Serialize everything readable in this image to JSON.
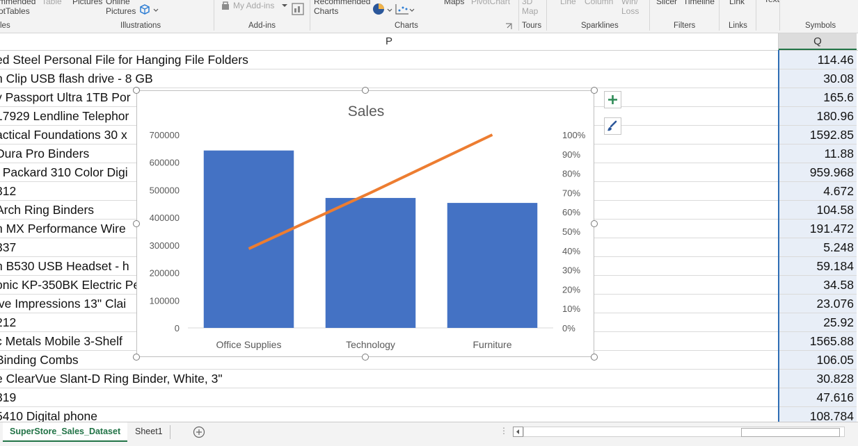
{
  "ribbon": {
    "items": [
      {
        "id": "rec-pivot",
        "lines": [
          "mmended",
          "otTables"
        ]
      },
      {
        "id": "table",
        "lines": [
          "Table"
        ],
        "gray": true
      },
      {
        "id": "pictures",
        "lines": [
          "Pictures"
        ]
      },
      {
        "id": "online-pictures",
        "lines": [
          "Online",
          "Pictures"
        ]
      },
      {
        "id": "my-addins",
        "lines": [
          "My Add-ins"
        ],
        "gray": true
      },
      {
        "id": "rec-charts",
        "lines": [
          "Recommended",
          "Charts"
        ]
      },
      {
        "id": "maps",
        "lines": [
          "Maps"
        ]
      },
      {
        "id": "pivotchart",
        "lines": [
          "PivotChart"
        ],
        "gray": true
      },
      {
        "id": "3dmap",
        "lines": [
          "3D",
          "Map"
        ],
        "gray": true
      },
      {
        "id": "line",
        "lines": [
          "Line"
        ],
        "gray": true
      },
      {
        "id": "column",
        "lines": [
          "Column"
        ],
        "gray": true
      },
      {
        "id": "winloss",
        "lines": [
          "Win/",
          "Loss"
        ],
        "gray": true
      },
      {
        "id": "slicer",
        "lines": [
          "Slicer"
        ]
      },
      {
        "id": "timeline",
        "lines": [
          "Timeline"
        ]
      },
      {
        "id": "link",
        "lines": [
          "Link"
        ]
      },
      {
        "id": "text",
        "lines": [
          "Text"
        ]
      }
    ],
    "groups": [
      "les",
      "Illustrations",
      "Add-ins",
      "Charts",
      "Tours",
      "Sparklines",
      "Filters",
      "Links",
      "Symbols"
    ]
  },
  "columns": {
    "p": "P",
    "q": "Q"
  },
  "rows": [
    {
      "p": "ed Steel Personal File for Hanging File Folders",
      "q": "114.46"
    },
    {
      "p": "n Clip USB flash drive - 8 GB",
      "q": "30.08"
    },
    {
      "p": "y Passport Ultra 1TB Por",
      "q": "165.6"
    },
    {
      "p": "17929 Lendline Telephor",
      "q": "180.96"
    },
    {
      "p": "actical Foundations 30 x",
      "q": "1592.85"
    },
    {
      "p": "Dura Pro Binders",
      "q": "11.88"
    },
    {
      "p": "t Packard 310 Color Digi",
      "q": "959.968"
    },
    {
      "p": " 312",
      "q": "4.672"
    },
    {
      "p": "Arch Ring Binders",
      "q": "104.58"
    },
    {
      "p": "h MX Performance Wire",
      "q": "191.472"
    },
    {
      "p": " 337",
      "q": "5.248"
    },
    {
      "p": "h B530 USB Headset - h",
      "q": "59.184"
    },
    {
      "p": "onic KP-350BK Electric Pe",
      "q": "34.58"
    },
    {
      "p": "ive Impressions 13\" Clai",
      "q": "23.076"
    },
    {
      "p": "212",
      "q": "25.92"
    },
    {
      "p": "c Metals Mobile 3-Shelf",
      "q": "1565.88"
    },
    {
      "p": "Binding Combs",
      "q": "106.05"
    },
    {
      "p": "e ClearVue Slant-D Ring Binder, White, 3\"",
      "q": "30.828"
    },
    {
      "p": " 319",
      "q": "47.616"
    },
    {
      "p": "5410 Digital phone",
      "q": "108.784"
    }
  ],
  "tabs": {
    "active": "SuperStore_Sales_Dataset",
    "other": "Sheet1"
  },
  "colors": {
    "bar": "#4472c4",
    "line": "#ed7d31",
    "excel_green": "#217346",
    "selection": "#2e6db4"
  },
  "chart_data": {
    "type": "bar",
    "title": "Sales",
    "categories": [
      "Office Supplies",
      "Technology",
      "Furniture"
    ],
    "series": [
      {
        "kind": "bar",
        "axis": "primary",
        "values": [
          643000,
          471000,
          453000
        ]
      },
      {
        "kind": "line",
        "axis": "secondary",
        "values": [
          0.41,
          0.7,
          1.0
        ]
      }
    ],
    "ylim": [
      0,
      700000
    ],
    "yticks": [
      0,
      100000,
      200000,
      300000,
      400000,
      500000,
      600000,
      700000
    ],
    "y2lim": [
      0,
      1
    ],
    "y2ticks": [
      "0%",
      "10%",
      "20%",
      "30%",
      "40%",
      "50%",
      "60%",
      "70%",
      "80%",
      "90%",
      "100%"
    ],
    "gridlines": false,
    "legend": "none"
  }
}
